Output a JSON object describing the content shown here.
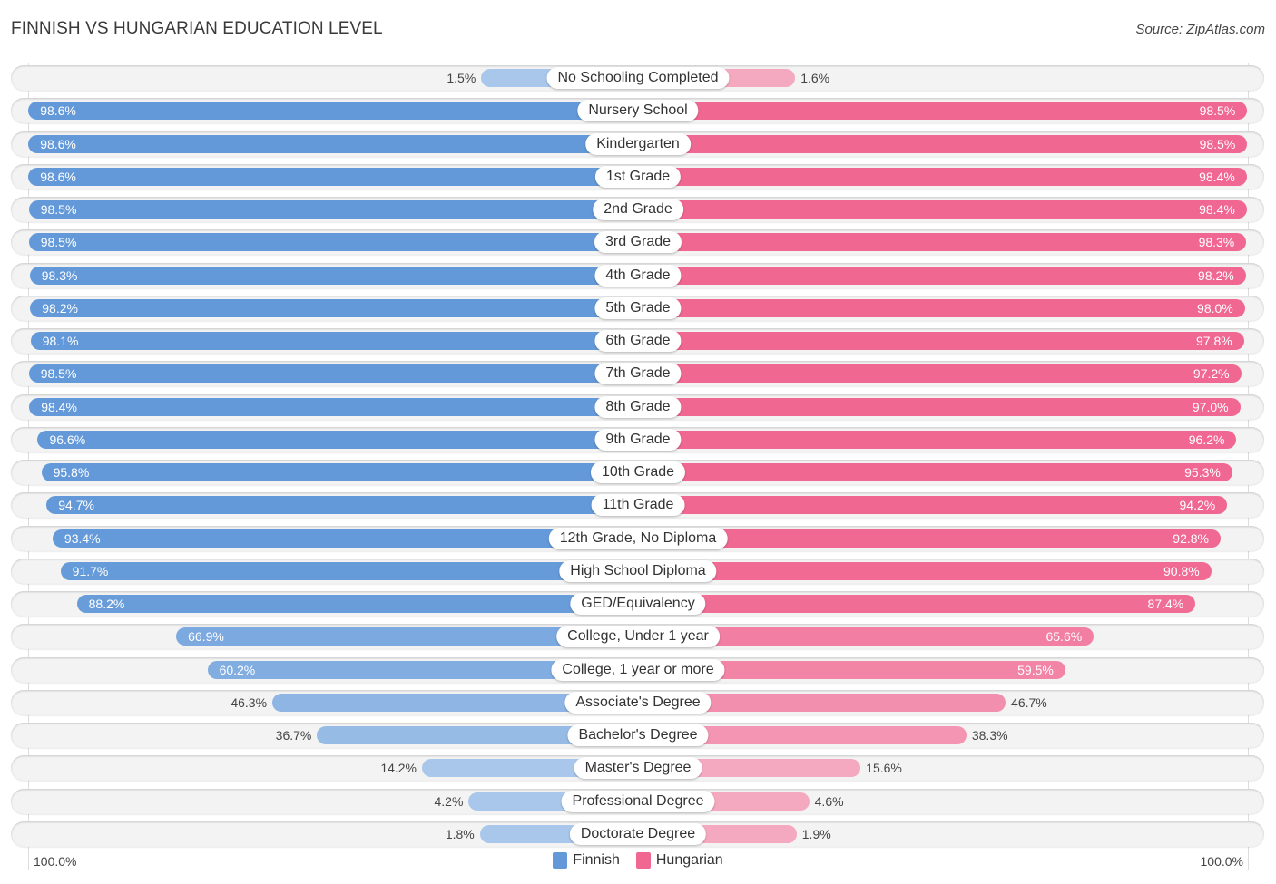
{
  "header": {
    "title": "FINNISH VS HUNGARIAN EDUCATION LEVEL",
    "source": "Source: ZipAtlas.com"
  },
  "colors": {
    "finnish": "#6399d9",
    "finnish_light": "#a9c7ea",
    "hungarian": "#f06792",
    "hungarian_light": "#f5a9c0"
  },
  "axis": {
    "left_label": "100.0%",
    "right_label": "100.0%"
  },
  "legend": [
    {
      "label": "Finnish",
      "color": "#6399d9"
    },
    {
      "label": "Hungarian",
      "color": "#f06792"
    }
  ],
  "chart_data": {
    "type": "bar",
    "orientation": "horizontal-diverging",
    "title": "FINNISH VS HUNGARIAN EDUCATION LEVEL",
    "xlabel": "",
    "ylabel": "",
    "xlim": [
      0,
      100
    ],
    "unit": "%",
    "legend_position": "bottom-center",
    "categories": [
      "No Schooling Completed",
      "Nursery School",
      "Kindergarten",
      "1st Grade",
      "2nd Grade",
      "3rd Grade",
      "4th Grade",
      "5th Grade",
      "6th Grade",
      "7th Grade",
      "8th Grade",
      "9th Grade",
      "10th Grade",
      "11th Grade",
      "12th Grade, No Diploma",
      "High School Diploma",
      "GED/Equivalency",
      "College, Under 1 year",
      "College, 1 year or more",
      "Associate's Degree",
      "Bachelor's Degree",
      "Master's Degree",
      "Professional Degree",
      "Doctorate Degree"
    ],
    "series": [
      {
        "name": "Finnish",
        "side": "left",
        "values": [
          1.5,
          98.6,
          98.6,
          98.6,
          98.5,
          98.5,
          98.3,
          98.2,
          98.1,
          98.5,
          98.4,
          96.6,
          95.8,
          94.7,
          93.4,
          91.7,
          88.2,
          66.9,
          60.2,
          46.3,
          36.7,
          14.2,
          4.2,
          1.8
        ],
        "labels": [
          "1.5%",
          "98.6%",
          "98.6%",
          "98.6%",
          "98.5%",
          "98.5%",
          "98.3%",
          "98.2%",
          "98.1%",
          "98.5%",
          "98.4%",
          "96.6%",
          "95.8%",
          "94.7%",
          "93.4%",
          "91.7%",
          "88.2%",
          "66.9%",
          "60.2%",
          "46.3%",
          "36.7%",
          "14.2%",
          "4.2%",
          "1.8%"
        ]
      },
      {
        "name": "Hungarian",
        "side": "right",
        "values": [
          1.6,
          98.5,
          98.5,
          98.4,
          98.4,
          98.3,
          98.2,
          98.0,
          97.8,
          97.2,
          97.0,
          96.2,
          95.3,
          94.2,
          92.8,
          90.8,
          87.4,
          65.6,
          59.5,
          46.7,
          38.3,
          15.6,
          4.6,
          1.9
        ],
        "labels": [
          "1.6%",
          "98.5%",
          "98.5%",
          "98.4%",
          "98.4%",
          "98.3%",
          "98.2%",
          "98.0%",
          "97.8%",
          "97.2%",
          "97.0%",
          "96.2%",
          "95.3%",
          "94.2%",
          "92.8%",
          "90.8%",
          "87.4%",
          "65.6%",
          "59.5%",
          "46.7%",
          "38.3%",
          "15.6%",
          "4.6%",
          "1.9%"
        ]
      }
    ]
  }
}
